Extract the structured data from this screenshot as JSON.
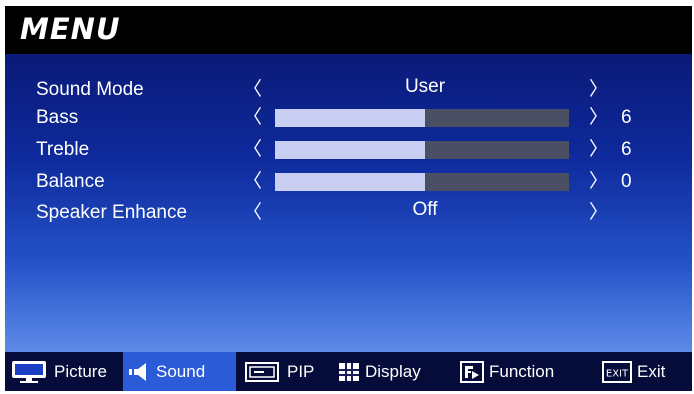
{
  "menu": {
    "title": "MENU"
  },
  "rows": [
    {
      "label": "Sound Mode",
      "value": "User"
    },
    {
      "label": "Bass",
      "level": 0.51,
      "number": "6"
    },
    {
      "label": "Treble",
      "level": 0.51,
      "number": "6"
    },
    {
      "label": "Balance",
      "level": 0.51,
      "number": "0"
    },
    {
      "label": "Speaker Enhance",
      "value": "Off"
    }
  ],
  "arrows": {
    "left": "〈",
    "right": "〉"
  },
  "tabs": [
    {
      "label": "Picture",
      "icon": "monitor-icon"
    },
    {
      "label": "Sound",
      "icon": "speaker-icon",
      "active": true
    },
    {
      "label": "PIP",
      "icon": "pip-icon"
    },
    {
      "label": "Display",
      "icon": "display-grid-icon"
    },
    {
      "label": "Function",
      "icon": "function-icon"
    },
    {
      "label": "Exit",
      "icon": "exit-icon"
    }
  ],
  "colors": {
    "titlebar": "#000000",
    "panel_top": "#0a1a78",
    "panel_bottom": "#5e8be8",
    "bar_fill": "#c9cff2",
    "bar_track": "#4a4f63",
    "active_tab": "#2b5bd6"
  }
}
